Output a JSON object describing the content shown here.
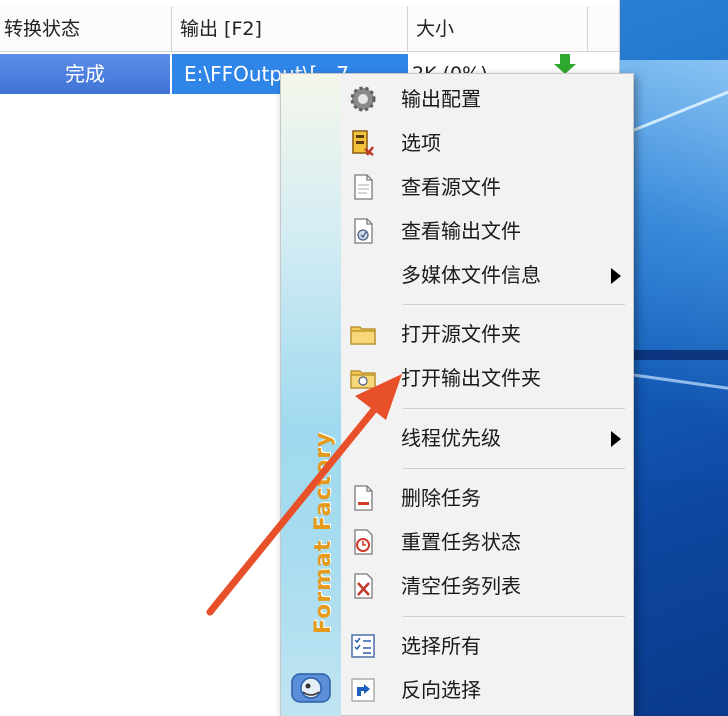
{
  "columns": [
    "转换状态",
    "输出 [F2]",
    "大小"
  ],
  "row": {
    "status": "完成",
    "output": "E:\\FFOutput\\[...7",
    "size": "2K  (0%)"
  },
  "menu": {
    "side_text": "Format Factory",
    "items": [
      {
        "label": "输出配置",
        "icon": "gear-icon"
      },
      {
        "label": "选项",
        "icon": "options-icon"
      },
      {
        "label": "查看源文件",
        "icon": "document-icon"
      },
      {
        "label": "查看输出文件",
        "icon": "output-file-icon"
      },
      {
        "label": "多媒体文件信息",
        "icon": "none",
        "submenu": true
      },
      {
        "label": "打开源文件夹",
        "icon": "folder-icon"
      },
      {
        "label": "打开输出文件夹",
        "icon": "open-folder-icon"
      },
      {
        "label": "线程优先级",
        "icon": "none",
        "submenu": true
      },
      {
        "label": "删除任务",
        "icon": "delete-task-icon"
      },
      {
        "label": "重置任务状态",
        "icon": "reset-icon"
      },
      {
        "label": "清空任务列表",
        "icon": "clear-list-icon"
      },
      {
        "label": "选择所有",
        "icon": "checklist-icon"
      },
      {
        "label": "反向选择",
        "icon": "invert-selection-icon"
      }
    ]
  },
  "colors": {
    "selection": "#2f86e8",
    "status_done": "#4a7fdf",
    "annotation_arrow": "#e8502a",
    "wallpaper": "#1565c0"
  }
}
